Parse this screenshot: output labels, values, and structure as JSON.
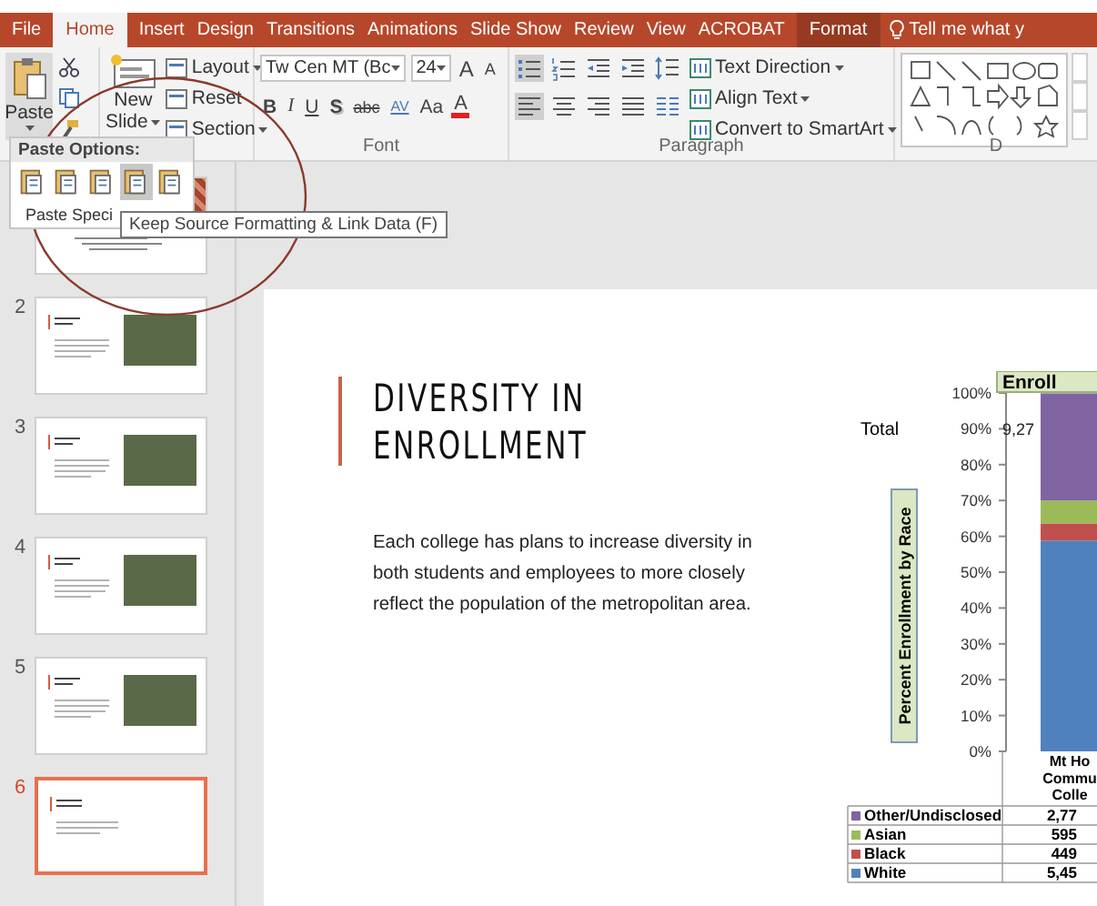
{
  "tabs": [
    {
      "label": "File",
      "selected": false,
      "contextual": false
    },
    {
      "label": "Home",
      "selected": true,
      "contextual": false
    },
    {
      "label": "Insert",
      "selected": false,
      "contextual": false
    },
    {
      "label": "Design",
      "selected": false,
      "contextual": false
    },
    {
      "label": "Transitions",
      "selected": false,
      "contextual": false
    },
    {
      "label": "Animations",
      "selected": false,
      "contextual": false
    },
    {
      "label": "Slide Show",
      "selected": false,
      "contextual": false
    },
    {
      "label": "Review",
      "selected": false,
      "contextual": false
    },
    {
      "label": "View",
      "selected": false,
      "contextual": false
    },
    {
      "label": "ACROBAT",
      "selected": false,
      "contextual": false
    },
    {
      "label": "Format",
      "selected": false,
      "contextual": true
    }
  ],
  "tell_me": "Tell me what y",
  "ribbon": {
    "paste": "Paste",
    "new_slide": [
      "New",
      "Slide"
    ],
    "slide_buttons": [
      {
        "label": "Layout",
        "dropdown": true
      },
      {
        "label": "Reset",
        "dropdown": false
      },
      {
        "label": "Section",
        "dropdown": true
      }
    ],
    "font": {
      "name": "Tw Cen MT (Bc",
      "size": "24",
      "label": "Font",
      "size_buttons": [
        {
          "glyph": "A",
          "kind": "grow"
        },
        {
          "glyph": "A",
          "kind": "shrink"
        }
      ],
      "format_buttons": [
        {
          "glyph": "B",
          "kind": "bold"
        },
        {
          "glyph": "I",
          "kind": "italic"
        },
        {
          "glyph": "U",
          "kind": "underline"
        },
        {
          "glyph": "S",
          "kind": "shadow"
        },
        {
          "glyph": "abc",
          "kind": "strike"
        },
        {
          "glyph": "AV",
          "kind": "spacing"
        },
        {
          "glyph": "Aa",
          "kind": "case"
        },
        {
          "glyph": "A",
          "kind": "color"
        }
      ]
    },
    "paragraph": {
      "label": "Paragraph",
      "list_buttons": [
        {
          "kind": "bullets",
          "selected": true
        },
        {
          "kind": "numbering",
          "selected": false
        },
        {
          "kind": "outdent",
          "selected": false
        },
        {
          "kind": "indent",
          "selected": false
        },
        {
          "kind": "spacing",
          "selected": false
        }
      ],
      "align_buttons": [
        {
          "kind": "left",
          "selected": true
        },
        {
          "kind": "center",
          "selected": false
        },
        {
          "kind": "right",
          "selected": false
        },
        {
          "kind": "justify",
          "selected": false
        },
        {
          "kind": "columns",
          "selected": false
        }
      ],
      "text_buttons": [
        {
          "label": "Text Direction",
          "dropdown": true
        },
        {
          "label": "Align Text",
          "dropdown": true
        },
        {
          "label": "Convert to SmartArt",
          "dropdown": true
        }
      ]
    },
    "drawing": {
      "label": "D"
    }
  },
  "paste_menu": {
    "header": "Paste Options:",
    "options": [
      {
        "selected": false
      },
      {
        "selected": false
      },
      {
        "selected": false
      },
      {
        "selected": true
      },
      {
        "selected": false
      }
    ],
    "special": "Paste Speci"
  },
  "tooltip": "Keep Source Formatting & Link Data (F)",
  "slides": [
    {
      "kind": "title",
      "selected": false
    },
    {
      "number": "2",
      "kind": "photo",
      "selected": false
    },
    {
      "number": "3",
      "kind": "photo",
      "selected": false
    },
    {
      "number": "4",
      "kind": "photo",
      "selected": false
    },
    {
      "number": "5",
      "kind": "photo",
      "selected": false
    },
    {
      "number": "6",
      "kind": "text",
      "selected": true
    }
  ],
  "slide": {
    "title": "DIVERSITY IN ENROLLMENT",
    "body": "Each college has plans to increase diversity in both students and employees to more closely reflect the population of the metropolitan area.",
    "chart": {
      "total_label": "Total",
      "total_value": "9,27",
      "chart_data": {
        "type": "bar",
        "stacked": true,
        "title": "Enroll",
        "ylabel": "Percent Enrollment by Race",
        "categories": [
          "Mt Ho\nCommu\nColle"
        ],
        "ylim": [
          0,
          100
        ],
        "legend": "bottom-left",
        "yticks": [
          {
            "value": 0,
            "label": "0%"
          },
          {
            "value": 10,
            "label": "10%"
          },
          {
            "value": 20,
            "label": "20%"
          },
          {
            "value": 30,
            "label": "30%"
          },
          {
            "value": 40,
            "label": "40%"
          },
          {
            "value": 50,
            "label": "50%"
          },
          {
            "value": 60,
            "label": "60%"
          },
          {
            "value": 70,
            "label": "70%"
          },
          {
            "value": 80,
            "label": "80%"
          },
          {
            "value": 90,
            "label": "90%"
          },
          {
            "value": 100,
            "label": "100%"
          }
        ],
        "series": [
          {
            "name": "Other/Undisclosed",
            "color": "#8064a2",
            "values": [
              29.9
            ]
          },
          {
            "name": "Asian",
            "color": "#9bbb59",
            "values": [
              6.4
            ]
          },
          {
            "name": "Black",
            "color": "#c0504d",
            "values": [
              4.8
            ]
          },
          {
            "name": "White",
            "color": "#4f81bd",
            "values": [
              58.8
            ]
          }
        ]
      },
      "data_table": [
        "2,77",
        "595",
        "449",
        "5,45"
      ]
    }
  }
}
